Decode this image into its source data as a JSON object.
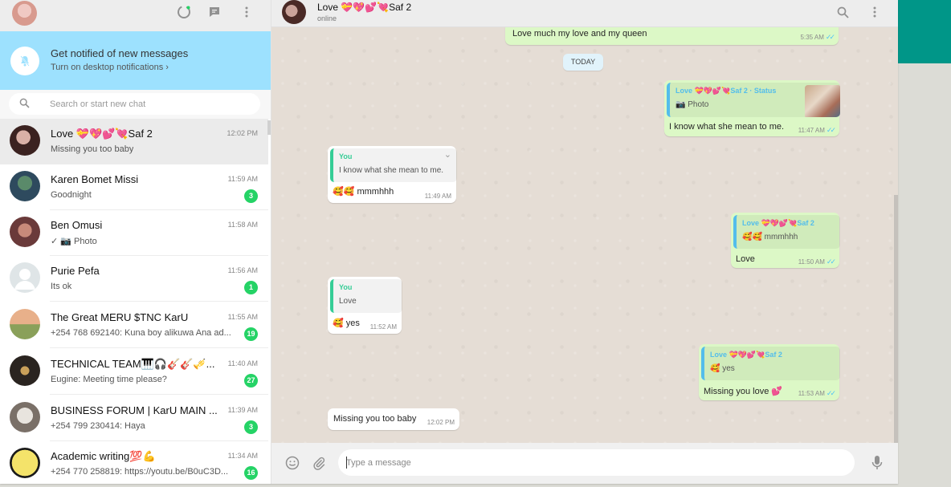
{
  "app": {
    "brand_color": "#009688"
  },
  "sidebar": {
    "notification": {
      "title": "Get notified of new messages",
      "subtitle": "Turn on desktop notifications ›"
    },
    "search": {
      "placeholder": "Search or start new chat"
    },
    "chats": [
      {
        "name": "Love 💝💖💕💘Saf 2",
        "preview": "Missing you too baby",
        "time": "12:02 PM",
        "badge": "",
        "active": true
      },
      {
        "name": "Karen Bomet Missi",
        "preview": "Goodnight",
        "time": "11:59 AM",
        "badge": "3"
      },
      {
        "name": "Ben Omusi",
        "preview": "✓ 📷 Photo",
        "time": "11:58 AM",
        "badge": ""
      },
      {
        "name": "Purie Pefa",
        "preview": "Its ok",
        "time": "11:56 AM",
        "badge": "1"
      },
      {
        "name": "The Great MERU $TNC KarU",
        "preview": "+254 768 692140: Kuna boy alikuwa Ana ad...",
        "time": "11:55 AM",
        "badge": "19"
      },
      {
        "name": "TECHNICAL TEAM🎹🎧🎸🎸🎺...",
        "preview": "Eugine: Meeting time please?",
        "time": "11:40 AM",
        "badge": "27"
      },
      {
        "name": "BUSINESS FORUM | KarU MAIN ...",
        "preview": "+254 799 230414: Haya",
        "time": "11:39 AM",
        "badge": "3"
      },
      {
        "name": "Academic writing💯💪",
        "preview": "+254 770 258819: https://youtu.be/B0uC3D...",
        "time": "11:34 AM",
        "badge": "16"
      }
    ]
  },
  "conversation": {
    "contact_name": "Love 💝💖💕💘Saf 2",
    "status": "online",
    "date_divider": "TODAY",
    "messages": {
      "m0": {
        "text": "Love much my  love and my queen",
        "time": "5:35 AM"
      },
      "m1": {
        "quote_name": "Love 💝💖💕💘Saf 2 · Status",
        "quote_text": "📷 Photo",
        "text": "I know what she mean to me.",
        "time": "11:47 AM"
      },
      "m2": {
        "quote_name": "You",
        "quote_text": "I know what she mean to me.",
        "text": "🥰🥰 mmmhhh",
        "time": "11:49 AM"
      },
      "m3": {
        "quote_name": "Love 💝💖💕💘Saf 2",
        "quote_text": "🥰🥰 mmmhhh",
        "text": "Love",
        "time": "11:50 AM"
      },
      "m4": {
        "quote_name": "You",
        "quote_text": "Love",
        "text": "🥰 yes",
        "time": "11:52 AM"
      },
      "m5": {
        "quote_name": "Love 💝💖💕💘Saf 2",
        "quote_text": "🥰 yes",
        "text": "Missing you love 💕",
        "time": "11:53 AM"
      },
      "m6": {
        "text": "Missing you too baby",
        "time": "12:02 PM"
      }
    },
    "composer": {
      "placeholder": "Type a message"
    }
  }
}
